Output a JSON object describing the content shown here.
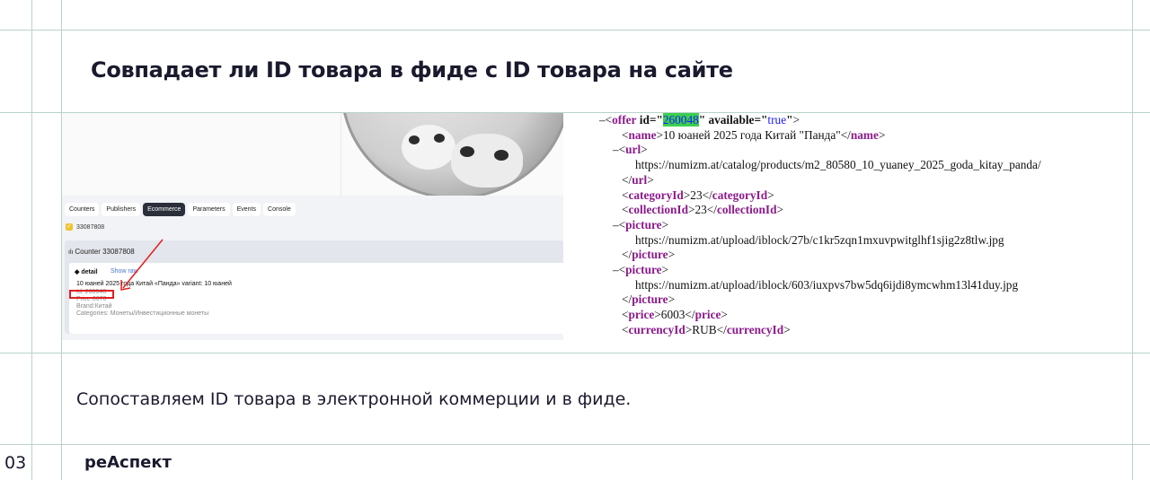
{
  "slide": {
    "title": "Совпадает ли ID товара в фиде с ID товара на сайте",
    "caption": "Сопоставляем ID товара в электронной коммерции и в фиде.",
    "page_number": "03",
    "logo_text": "реАспект"
  },
  "screenshot": {
    "tabs": [
      "Counters",
      "Publishers",
      "Ecommerce",
      "Parameters",
      "Events",
      "Console"
    ],
    "active_tab": "Ecommerce",
    "counter_checked": "33087808",
    "panel_title": "Counter 33087808",
    "detail_label": "detail",
    "show_raw": "Show raw",
    "product_line": "10 юаней 2025 года Китай «Панда» variant: 10 юаней",
    "id_line": "Id: 260048",
    "price_line": "Price:6670",
    "brand_line": "Brand:Китай",
    "categories_line": "Categories: Монеты/Инвестиционные монеты"
  },
  "xml": {
    "offer_tag": "offer",
    "id_attr": "id",
    "id_value": "260048",
    "available_attr": "available",
    "available_value": "true",
    "name_tag": "name",
    "name_text": "10 юаней 2025 года Китай \"Панда\"",
    "url_tag": "url",
    "url_text": "https://numizm.at/catalog/products/m2_80580_10_yuaney_2025_goda_kitay_panda/",
    "categoryId_tag": "categoryId",
    "categoryId_text": "23",
    "collectionId_tag": "collectionId",
    "collectionId_text": "23",
    "picture_tag": "picture",
    "picture1_text": "https://numizm.at/upload/iblock/27b/c1kr5zqn1mxuvpwitglhf1sjig2z8tlw.jpg",
    "picture2_text": "https://numizm.at/upload/iblock/603/iuxpvs7bw5dq6ijdi8ymcwhm13l41duy.jpg",
    "price_tag": "price",
    "price_text": "6003",
    "currencyId_tag": "currencyId",
    "currencyId_text": "RUB"
  }
}
